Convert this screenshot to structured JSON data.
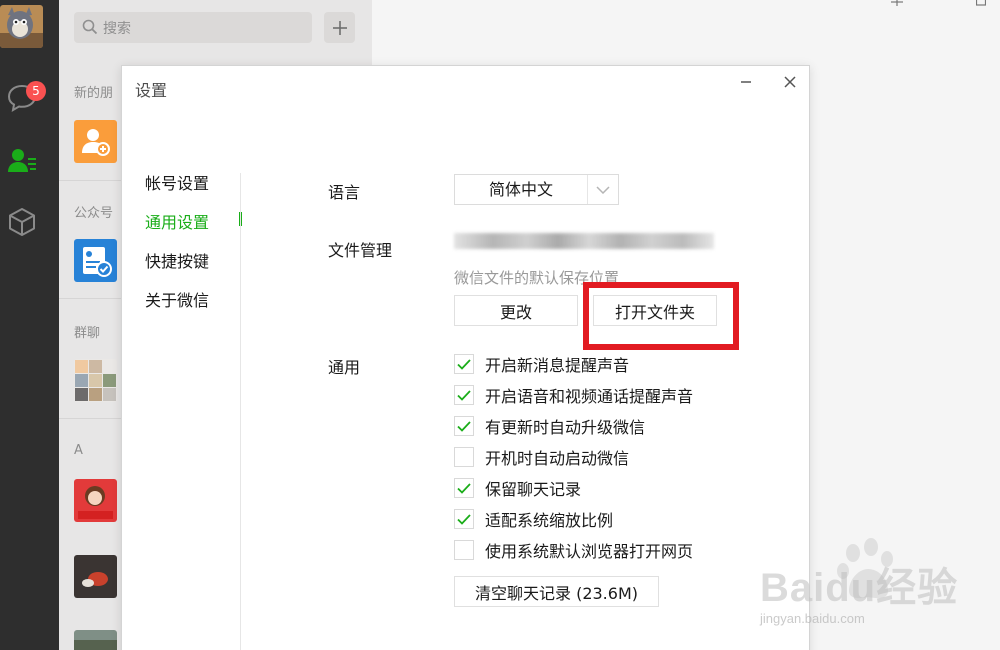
{
  "search": {
    "placeholder": "搜索"
  },
  "rail": {
    "badge_count": "5"
  },
  "list": {
    "sections": [
      "新的朋",
      "公众号",
      "群聊",
      "A"
    ]
  },
  "dialog": {
    "title": "设置",
    "menu": [
      {
        "label": "帐号设置",
        "active": false
      },
      {
        "label": "通用设置",
        "active": true
      },
      {
        "label": "快捷按键",
        "active": false
      },
      {
        "label": "关于微信",
        "active": false
      }
    ],
    "language": {
      "label": "语言",
      "value": "简体中文"
    },
    "file_mgmt": {
      "label": "文件管理",
      "hint": "微信文件的默认保存位置",
      "change_label": "更改",
      "open_folder_label": "打开文件夹"
    },
    "general": {
      "label": "通用",
      "options": [
        {
          "label": "开启新消息提醒声音",
          "checked": true
        },
        {
          "label": "开启语音和视频通话提醒声音",
          "checked": true
        },
        {
          "label": "有更新时自动升级微信",
          "checked": true
        },
        {
          "label": "开机时自动启动微信",
          "checked": false
        },
        {
          "label": "保留聊天记录",
          "checked": true
        },
        {
          "label": "适配系统缩放比例",
          "checked": true
        },
        {
          "label": "使用系统默认浏览器打开网页",
          "checked": false
        }
      ],
      "clear_label": "清空聊天记录 (23.6M)"
    }
  },
  "watermark": {
    "brand": "Baidu经验",
    "url": "jingyan.baidu.com"
  },
  "colors": {
    "accent": "#1aad19",
    "highlight": "#e21b22",
    "badge": "#fa5151"
  }
}
